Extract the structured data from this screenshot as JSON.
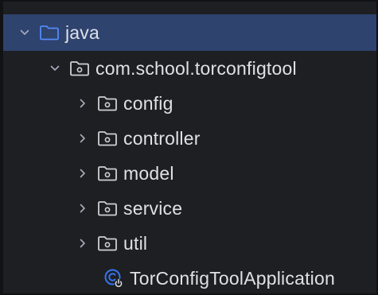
{
  "tree": {
    "root": {
      "label": "java",
      "expanded": true,
      "icon": "folder-icon",
      "accent": "#548af7"
    },
    "package": {
      "label": "com.school.torconfigtool",
      "expanded": true,
      "icon": "package-icon"
    },
    "children": [
      {
        "label": "config",
        "expanded": false,
        "icon": "package-icon"
      },
      {
        "label": "controller",
        "expanded": false,
        "icon": "package-icon"
      },
      {
        "label": "model",
        "expanded": false,
        "icon": "package-icon"
      },
      {
        "label": "service",
        "expanded": false,
        "icon": "package-icon"
      },
      {
        "label": "util",
        "expanded": false,
        "icon": "package-icon"
      }
    ],
    "app_class": {
      "label": "TorConfigToolApplication",
      "icon": "spring-boot-class-icon",
      "accent": "#3574f0"
    },
    "selection_color": "#2e436e"
  }
}
